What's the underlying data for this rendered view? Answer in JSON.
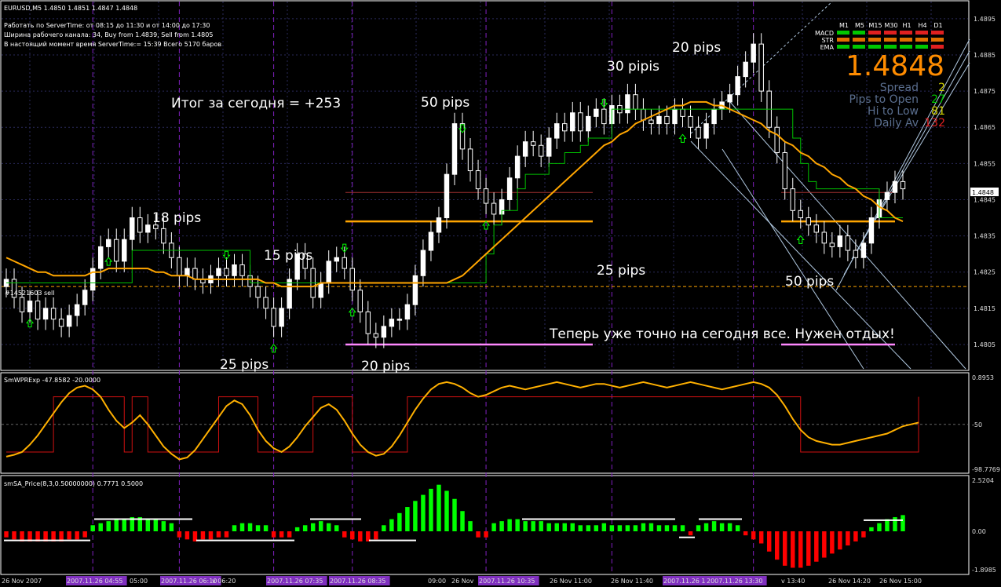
{
  "header": {
    "symbol_line": "EURUSD,M5  1.4850 1.4851 1.4847 1.4848",
    "info_lines": [
      "Работать по ServerTime: от 08:15 до 11:30  и от 14:00 до 17:30",
      "Ширина рабочего канала: 34, Buy from 1.4839, Sell from 1.4805",
      "В настоящий момент время ServerTime:= 15:39  Всего 5170 баров"
    ]
  },
  "info_panel": {
    "timeframes": [
      "M1",
      "M5",
      "M15",
      "M30",
      "H1",
      "H4",
      "D1"
    ],
    "row_labels": [
      "MACD",
      "STR",
      "EMA"
    ],
    "signal_colors": [
      [
        "#00c800",
        "#00c800",
        "#e02020",
        "#e02020",
        "#e02020",
        "#e02020",
        "#e02020"
      ],
      [
        "#e07000",
        "#e07000",
        "#e07000",
        "#e07000",
        "#e07000",
        "#e07000",
        "#e07000"
      ],
      [
        "#00c800",
        "#00c800",
        "#00c800",
        "#00c800",
        "#00c800",
        "#00c800",
        "#e02020"
      ]
    ],
    "price": "1.4848",
    "stats": [
      {
        "label": "Spread",
        "value": "2",
        "color": "#d4d400"
      },
      {
        "label": "Pips to Open",
        "value": "27",
        "color": "#00c800"
      },
      {
        "label": "Hi to Low",
        "value": "81",
        "color": "#d4d400"
      },
      {
        "label": "Daily Av",
        "value": "132",
        "color": "#e02020"
      }
    ]
  },
  "annotations": {
    "summary": "Итог за сегодня = +253",
    "closing": "Теперь уже точно на сегодня все. Нужен отдых!",
    "pips_18": "18 pips",
    "pips_15": "15 pips",
    "pips_25a": "25 pips",
    "pips_20a": "20  pips",
    "pips_50a": "50 pips",
    "pips_30": "30 pipis",
    "pips_20b": "20 pips",
    "pips_25b": "25 pips",
    "pips_50b": "50 pips",
    "order_label": "#14521603 sell"
  },
  "colors": {
    "background": "#000000",
    "bull": "#ffffff",
    "bear": "#000000",
    "ma": "#ffa500",
    "stop": "#00c000",
    "separator": "#8020c0",
    "up": "#00ff00",
    "down": "#ff0000"
  },
  "chart_data": [
    {
      "type": "candlestick",
      "symbol": "EURUSD",
      "timeframe": "M5",
      "ohlc_last": {
        "open": 1.485,
        "high": 1.4851,
        "low": 1.4847,
        "close": 1.4848
      },
      "current_price": 1.4848,
      "ylim": [
        1.48,
        1.4898
      ],
      "yticks": [
        "1.4895",
        "1.4885",
        "1.4875",
        "1.4865",
        "1.4855",
        "1.4845",
        "1.4835",
        "1.4825",
        "1.4815",
        "1.4805"
      ],
      "levels": [
        1.4839,
        1.4821
      ],
      "closes": [
        1.4823,
        1.4818,
        1.4814,
        1.4817,
        1.4812,
        1.4815,
        1.4812,
        1.481,
        1.4813,
        1.4816,
        1.482,
        1.4826,
        1.4832,
        1.4834,
        1.4828,
        1.4834,
        1.484,
        1.4836,
        1.4838,
        1.4837,
        1.4833,
        1.4829,
        1.4824,
        1.4826,
        1.4823,
        1.4822,
        1.4824,
        1.4826,
        1.4824,
        1.4827,
        1.4824,
        1.4821,
        1.4818,
        1.4815,
        1.481,
        1.4815,
        1.4823,
        1.483,
        1.4826,
        1.4818,
        1.4822,
        1.4828,
        1.4829,
        1.4826,
        1.482,
        1.4814,
        1.4808,
        1.4807,
        1.481,
        1.4812,
        1.4812,
        1.4816,
        1.4824,
        1.4831,
        1.4836,
        1.484,
        1.4852,
        1.4866,
        1.4859,
        1.4853,
        1.4848,
        1.4844,
        1.4841,
        1.4845,
        1.4851,
        1.4857,
        1.4861,
        1.486,
        1.4857,
        1.4862,
        1.4866,
        1.4864,
        1.4869,
        1.4864,
        1.4868,
        1.487,
        1.4866,
        1.4871,
        1.4869,
        1.4874,
        1.487,
        1.4867,
        1.4866,
        1.4868,
        1.4866,
        1.487,
        1.4868,
        1.4865,
        1.4862,
        1.4866,
        1.487,
        1.4872,
        1.4874,
        1.4879,
        1.4883,
        1.4888,
        1.4875,
        1.4865,
        1.4858,
        1.4848,
        1.4842,
        1.484,
        1.4838,
        1.4836,
        1.4833,
        1.4832,
        1.4835,
        1.4831,
        1.4829,
        1.4833,
        1.484,
        1.4845,
        1.4847,
        1.485,
        1.4848
      ],
      "stop_line": [
        1.4822,
        1.4822,
        1.4822,
        1.4822,
        1.4822,
        1.4822,
        1.4822,
        1.4822,
        1.4822,
        1.4822,
        1.4822,
        1.4822,
        1.4822,
        1.4822,
        1.4822,
        1.4822,
        1.4831,
        1.4831,
        1.4831,
        1.4831,
        1.4831,
        1.4831,
        1.4831,
        1.4831,
        1.4831,
        1.4831,
        1.4831,
        1.4831,
        1.4831,
        1.4831,
        1.4831,
        1.4822,
        1.4822,
        1.4822,
        1.4822,
        1.4822,
        1.4822,
        1.4822,
        1.4822,
        1.4822,
        1.4822,
        1.4822,
        1.4822,
        1.4822,
        1.4822,
        1.4822,
        1.4822,
        1.4822,
        1.4822,
        1.4822,
        1.4822,
        1.4822,
        1.4822,
        1.4822,
        1.4822,
        1.4822,
        1.4822,
        1.4822,
        1.4822,
        1.4822,
        1.4822,
        1.483,
        1.4838,
        1.4842,
        1.4842,
        1.4848,
        1.4852,
        1.4852,
        1.4852,
        1.4855,
        1.4855,
        1.4858,
        1.4858,
        1.486,
        1.4862,
        1.4862,
        1.4862,
        1.487,
        1.487,
        1.487,
        1.487,
        1.487,
        1.487,
        1.487,
        1.487,
        1.487,
        1.487,
        1.487,
        1.487,
        1.487,
        1.487,
        1.487,
        1.487,
        1.487,
        1.487,
        1.487,
        1.487,
        1.487,
        1.487,
        1.487,
        1.4862,
        1.4855,
        1.485,
        1.4848,
        1.4848,
        1.4848,
        1.4848,
        1.4848,
        1.4848,
        1.4848,
        1.4848,
        1.484,
        1.484,
        1.484,
        1.484
      ],
      "ma_line": [
        1.4829,
        1.4828,
        1.4827,
        1.4826,
        1.4825,
        1.4825,
        1.4824,
        1.4824,
        1.4824,
        1.4824,
        1.4824,
        1.4825,
        1.4825,
        1.4826,
        1.4826,
        1.4826,
        1.4826,
        1.4826,
        1.4826,
        1.4825,
        1.4825,
        1.4824,
        1.4824,
        1.4824,
        1.4823,
        1.4823,
        1.4823,
        1.4823,
        1.4823,
        1.4823,
        1.4823,
        1.4823,
        1.4823,
        1.4822,
        1.4822,
        1.4821,
        1.4821,
        1.4821,
        1.4821,
        1.4821,
        1.4822,
        1.4822,
        1.4822,
        1.4822,
        1.4822,
        1.4822,
        1.4822,
        1.4822,
        1.4822,
        1.4822,
        1.4822,
        1.4822,
        1.4822,
        1.4822,
        1.4822,
        1.4822,
        1.4822,
        1.4823,
        1.4824,
        1.4826,
        1.4828,
        1.483,
        1.4832,
        1.4834,
        1.4836,
        1.4838,
        1.484,
        1.4842,
        1.4844,
        1.4846,
        1.4848,
        1.485,
        1.4852,
        1.4854,
        1.4856,
        1.4858,
        1.486,
        1.4861,
        1.4863,
        1.4864,
        1.4866,
        1.4867,
        1.4868,
        1.4869,
        1.487,
        1.4871,
        1.4871,
        1.4872,
        1.4872,
        1.4872,
        1.4871,
        1.4871,
        1.487,
        1.4869,
        1.4868,
        1.4867,
        1.4866,
        1.4864,
        1.4863,
        1.4861,
        1.486,
        1.4858,
        1.4857,
        1.4855,
        1.4854,
        1.4852,
        1.4851,
        1.4849,
        1.4848,
        1.4846,
        1.4845,
        1.4843,
        1.4842,
        1.484,
        1.4839
      ]
    },
    {
      "type": "line",
      "name": "SmWPRExp",
      "header": "SmWPRExp -47.8582 -20.0000",
      "ylim": [
        -98.7769,
        1.0
      ],
      "yticks": [
        "0.8953",
        "-50",
        "-98.7769"
      ],
      "level": -50,
      "values": [
        -85,
        -83,
        -80,
        -72,
        -62,
        -50,
        -38,
        -26,
        -16,
        -10,
        -8,
        -12,
        -20,
        -34,
        -46,
        -54,
        -48,
        -40,
        -50,
        -62,
        -74,
        -82,
        -88,
        -86,
        -78,
        -66,
        -54,
        -42,
        -30,
        -24,
        -28,
        -40,
        -56,
        -68,
        -76,
        -80,
        -74,
        -64,
        -52,
        -42,
        -32,
        -28,
        -34,
        -46,
        -60,
        -72,
        -80,
        -84,
        -82,
        -74,
        -62,
        -48,
        -34,
        -22,
        -12,
        -6,
        -4,
        -6,
        -10,
        -16,
        -20,
        -18,
        -14,
        -10,
        -8,
        -10,
        -12,
        -10,
        -8,
        -6,
        -4,
        -6,
        -8,
        -10,
        -8,
        -6,
        -6,
        -8,
        -10,
        -8,
        -6,
        -4,
        -6,
        -8,
        -10,
        -8,
        -6,
        -4,
        -6,
        -8,
        -10,
        -12,
        -10,
        -8,
        -6,
        -4,
        -6,
        -10,
        -18,
        -30,
        -44,
        -56,
        -64,
        -68,
        -70,
        -72,
        -72,
        -70,
        -68,
        -66,
        -64,
        -62,
        -60,
        -56,
        -52,
        -50,
        -48
      ]
    },
    {
      "type": "bar",
      "name": "smSA_Price",
      "header": "smSA_Price(8,3,0.50000000) 0.7771 0.5000",
      "ylim": [
        -1.8985,
        2.5204
      ],
      "yticks": [
        "2.5204",
        "0.00",
        "-1.8985"
      ],
      "values": [
        -0.3,
        -0.4,
        -0.5,
        -0.5,
        -0.5,
        -0.5,
        -0.5,
        -0.5,
        -0.4,
        -0.4,
        -0.3,
        0.3,
        0.4,
        0.5,
        0.6,
        0.6,
        0.7,
        0.7,
        0.6,
        0.6,
        0.5,
        0.4,
        -0.3,
        -0.4,
        -0.5,
        -0.4,
        -0.4,
        -0.3,
        -0.3,
        0.3,
        0.4,
        0.4,
        0.3,
        0.3,
        -0.3,
        -0.3,
        -0.3,
        0.2,
        0.3,
        0.4,
        0.5,
        0.4,
        0.3,
        -0.3,
        -0.4,
        -0.5,
        -0.5,
        -0.4,
        0.3,
        0.6,
        0.9,
        1.2,
        1.5,
        1.8,
        2.1,
        2.3,
        2.0,
        1.6,
        1.0,
        0.5,
        -0.3,
        -0.3,
        0.4,
        0.5,
        0.6,
        0.6,
        0.5,
        0.5,
        0.5,
        0.4,
        0.4,
        0.4,
        0.4,
        0.3,
        0.3,
        0.3,
        0.4,
        0.3,
        0.3,
        0.3,
        0.3,
        0.4,
        0.4,
        0.3,
        0.3,
        0.3,
        0.3,
        -0.2,
        0.3,
        0.4,
        0.5,
        0.4,
        0.4,
        0.3,
        -0.2,
        -0.4,
        -0.6,
        -1.0,
        -1.4,
        -1.7,
        -1.8,
        -1.8,
        -1.7,
        -1.5,
        -1.3,
        -1.1,
        -0.9,
        -0.7,
        -0.5,
        -0.3,
        0.2,
        0.4,
        0.6,
        0.7,
        0.8
      ]
    }
  ],
  "time_axis": [
    {
      "label": "26 Nov 2007",
      "highlight": false
    },
    {
      "label": "2007.11.26 04:55",
      "highlight": true
    },
    {
      "label": "05:00",
      "highlight": false
    },
    {
      "label": "2007.11.26 06:10",
      "highlight": true
    },
    {
      "label": "v 06:20",
      "highlight": false
    },
    {
      "label": "2007.11.26 07:35",
      "highlight": true
    },
    {
      "label": "2007.11.26 08:35",
      "highlight": true
    },
    {
      "label": "09:00",
      "highlight": false
    },
    {
      "label": "26 Nov",
      "highlight": false
    },
    {
      "label": "2007.11.26 10:35",
      "highlight": true
    },
    {
      "label": "26 Nov 11:00",
      "highlight": false
    },
    {
      "label": "26 Nov 11:40",
      "highlight": false
    },
    {
      "label": "2007.11.26 12:55",
      "highlight": true
    },
    {
      "label": "2007.11.26 13:30",
      "highlight": true
    },
    {
      "label": "v 13:40",
      "highlight": false
    },
    {
      "label": "26 Nov 14:20",
      "highlight": false
    },
    {
      "label": "26 Nov 15:00",
      "highlight": false
    }
  ]
}
